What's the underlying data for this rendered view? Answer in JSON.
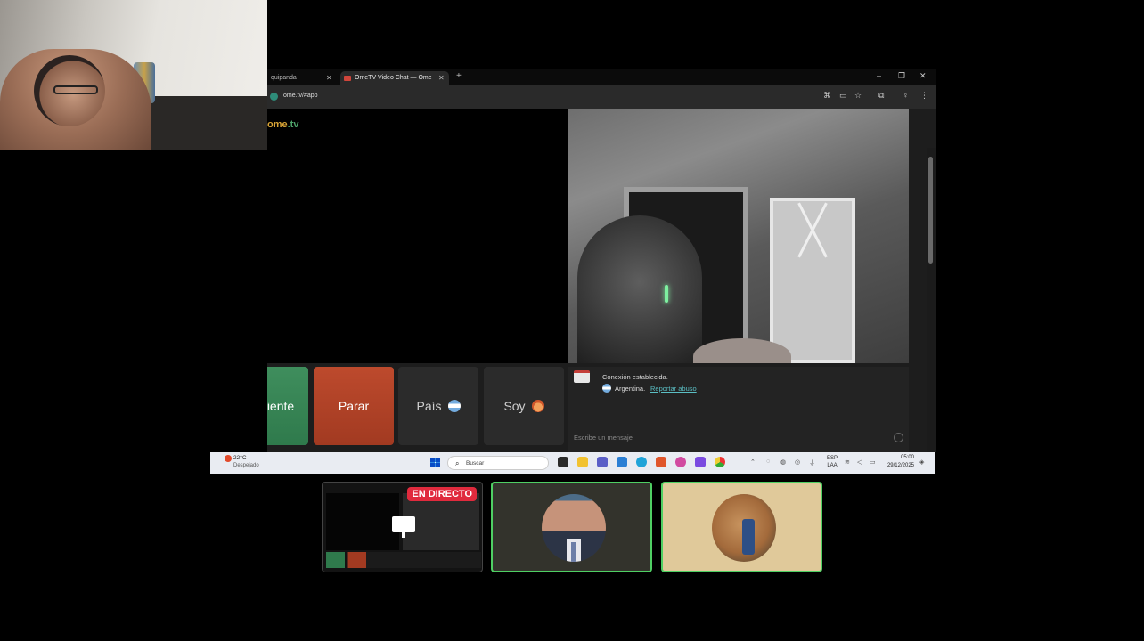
{
  "browser": {
    "tabs": [
      {
        "label": "quipanda"
      },
      {
        "label": "OmeTV Video Chat — Ome"
      }
    ],
    "url": "ome.tv/#app",
    "logo": {
      "part1": "ome",
      "part2": ".tv"
    }
  },
  "controls": {
    "next_label": "Siguiente",
    "stop_label": "Parar",
    "country_label": "País",
    "gender_label": "Soy"
  },
  "chat": {
    "status": "Conexión establecida.",
    "country": "Argentina.",
    "report_link": "Reportar abuso",
    "input_placeholder": "Escribe un mensaje"
  },
  "taskbar": {
    "weather_temp": "22°C",
    "weather_desc": "Despejado",
    "search_placeholder": "Buscar",
    "lang_line1": "ESP",
    "lang_line2": "LAA",
    "time": "05:00",
    "date": "29/12/2025"
  },
  "scenes": {
    "live_badge": "EN DIRECTO"
  },
  "colors": {
    "next": "#3f8e5d",
    "stop": "#bd4a2d",
    "live": "#e02a3d",
    "scene_border_active": "#4fcf63"
  }
}
